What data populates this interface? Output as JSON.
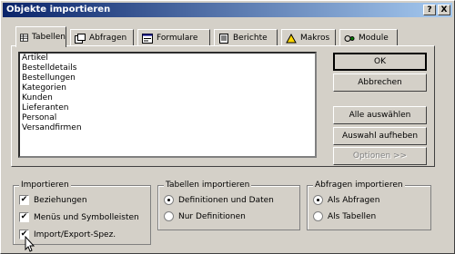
{
  "window": {
    "title": "Objekte importieren",
    "help_label": "?",
    "close_label": "X"
  },
  "tabs": [
    {
      "label": "Tabellen",
      "icon": "table-icon",
      "active": true
    },
    {
      "label": "Abfragen",
      "icon": "query-icon",
      "active": false
    },
    {
      "label": "Formulare",
      "icon": "form-icon",
      "active": false
    },
    {
      "label": "Berichte",
      "icon": "report-icon",
      "active": false
    },
    {
      "label": "Makros",
      "icon": "macro-icon",
      "active": false
    },
    {
      "label": "Module",
      "icon": "module-icon",
      "active": false
    }
  ],
  "list_items": [
    "Artikel",
    "Bestelldetails",
    "Bestellungen",
    "Kategorien",
    "Kunden",
    "Lieferanten",
    "Personal",
    "Versandfirmen"
  ],
  "buttons": {
    "ok": "OK",
    "cancel": "Abbrechen",
    "select_all": "Alle auswählen",
    "deselect": "Auswahl aufheben",
    "options": "Optionen >>"
  },
  "groups": {
    "import": {
      "label": "Importieren",
      "items": [
        {
          "label": "Beziehungen",
          "checked": true
        },
        {
          "label": "Menüs und Symbolleisten",
          "checked": true
        },
        {
          "label": "Import/Export-Spez.",
          "checked": true
        }
      ]
    },
    "tables": {
      "label": "Tabellen importieren",
      "options": [
        {
          "label": "Definitionen und Daten",
          "selected": true
        },
        {
          "label": "Nur Definitionen",
          "selected": false
        }
      ]
    },
    "queries": {
      "label": "Abfragen importieren",
      "options": [
        {
          "label": "Als Abfragen",
          "selected": true
        },
        {
          "label": "Als Tabellen",
          "selected": false
        }
      ]
    }
  },
  "colors": {
    "titlebar_start": "#0a246a",
    "titlebar_end": "#a6caf0",
    "face": "#d4d0c8"
  }
}
